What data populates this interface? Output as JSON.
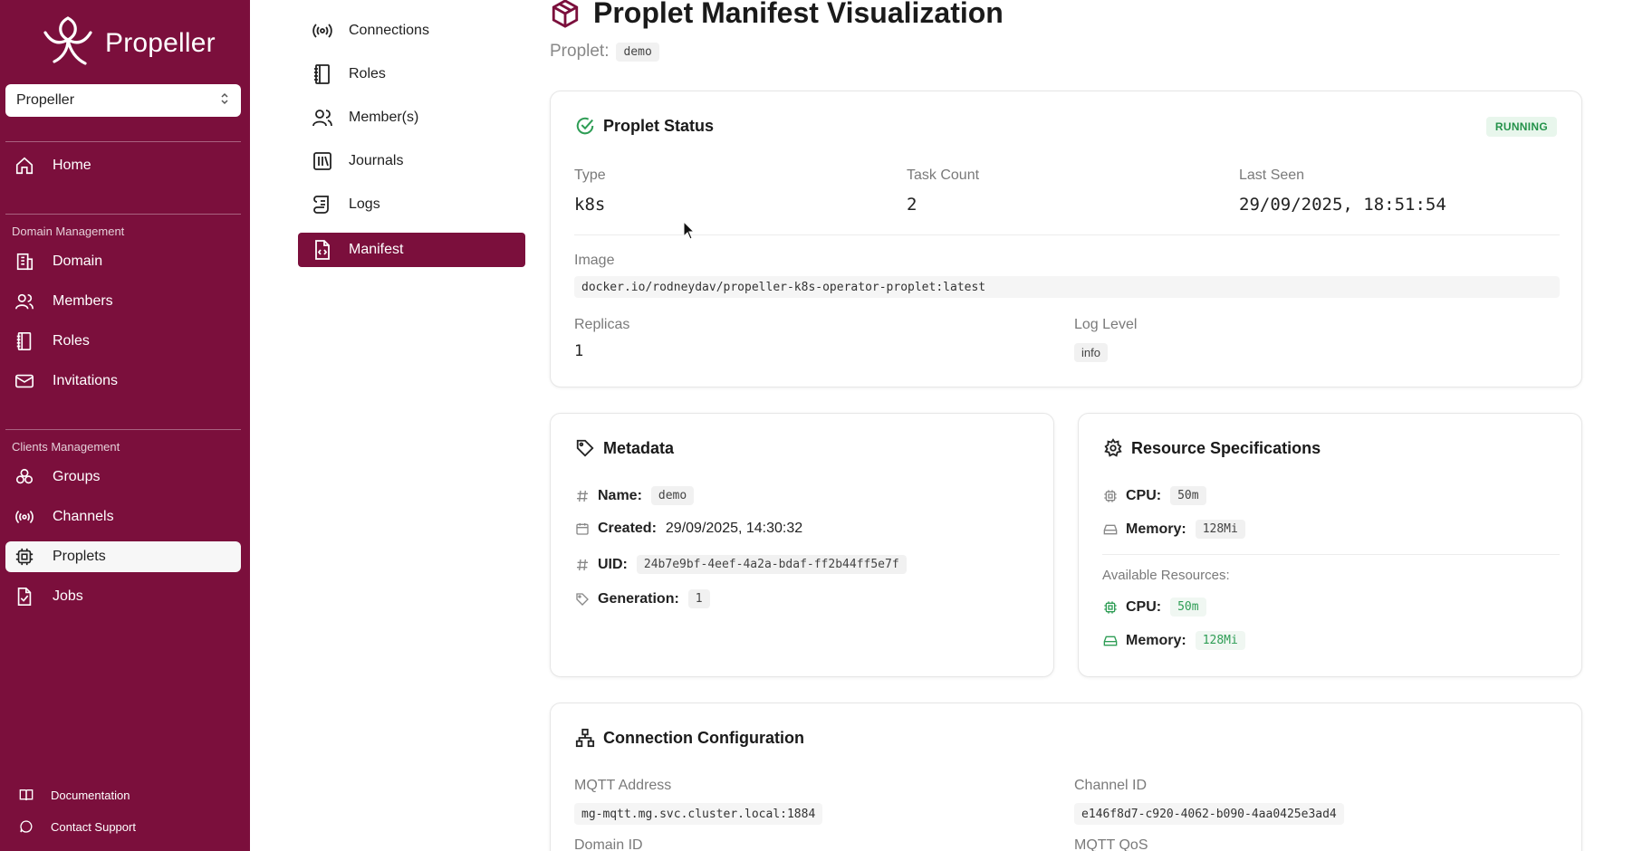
{
  "sidebar": {
    "brand": "Propeller",
    "domain_select": "Propeller",
    "home": "Home",
    "domain_section": "Domain Management",
    "domain_items": [
      "Domain",
      "Members",
      "Roles",
      "Invitations"
    ],
    "clients_section": "Clients Management",
    "client_items": [
      "Groups",
      "Channels",
      "Proplets",
      "Jobs"
    ],
    "active_item": "Proplets",
    "footer": [
      "Documentation",
      "Contact Support"
    ],
    "color": "#7b0f3c"
  },
  "subnav": {
    "items": [
      "Connections",
      "Roles",
      "Member(s)",
      "Journals",
      "Logs",
      "Manifest"
    ],
    "active_item": "Manifest"
  },
  "header": {
    "title": "Proplet Manifest Visualization",
    "proplet_label": "Proplet:",
    "proplet_name": "demo"
  },
  "status_card": {
    "title": "Proplet Status",
    "badge": "RUNNING",
    "type_label": "Type",
    "type_value": "k8s",
    "task_count_label": "Task Count",
    "task_count_value": "2",
    "last_seen_label": "Last Seen",
    "last_seen_value": "29/09/2025, 18:51:54",
    "image_label": "Image",
    "image_value": "docker.io/rodneydav/propeller-k8s-operator-proplet:latest",
    "replicas_label": "Replicas",
    "replicas_value": "1",
    "log_level_label": "Log Level",
    "log_level_value": "info"
  },
  "metadata_card": {
    "title": "Metadata",
    "name_label": "Name:",
    "name_value": "demo",
    "created_label": "Created:",
    "created_value": "29/09/2025, 14:30:32",
    "uid_label": "UID:",
    "uid_value": "24b7e9bf-4eef-4a2a-bdaf-ff2b44ff5e7f",
    "generation_label": "Generation:",
    "generation_value": "1"
  },
  "resources_card": {
    "title": "Resource Specifications",
    "cpu_label": "CPU:",
    "cpu_value": "50m",
    "memory_label": "Memory:",
    "memory_value": "128Mi",
    "available_label": "Available Resources:",
    "avail_cpu_label": "CPU:",
    "avail_cpu_value": "50m",
    "avail_memory_label": "Memory:",
    "avail_memory_value": "128Mi"
  },
  "connection_card": {
    "title": "Connection Configuration",
    "mqtt_address_label": "MQTT Address",
    "mqtt_address_value": "mg-mqtt.mg.svc.cluster.local:1884",
    "channel_id_label": "Channel ID",
    "channel_id_value": "e146f8d7-c920-4062-b090-4aa0425e3ad4",
    "domain_id_label": "Domain ID",
    "mqtt_qos_label": "MQTT QoS"
  },
  "icons": {
    "brand": "propeller-logo-icon",
    "select": "chevron-updown-icon",
    "status": "check-circle-icon",
    "metadata": "tag-icon",
    "resources": "gear-icon",
    "connection": "network-icon",
    "title": "package-icon"
  }
}
